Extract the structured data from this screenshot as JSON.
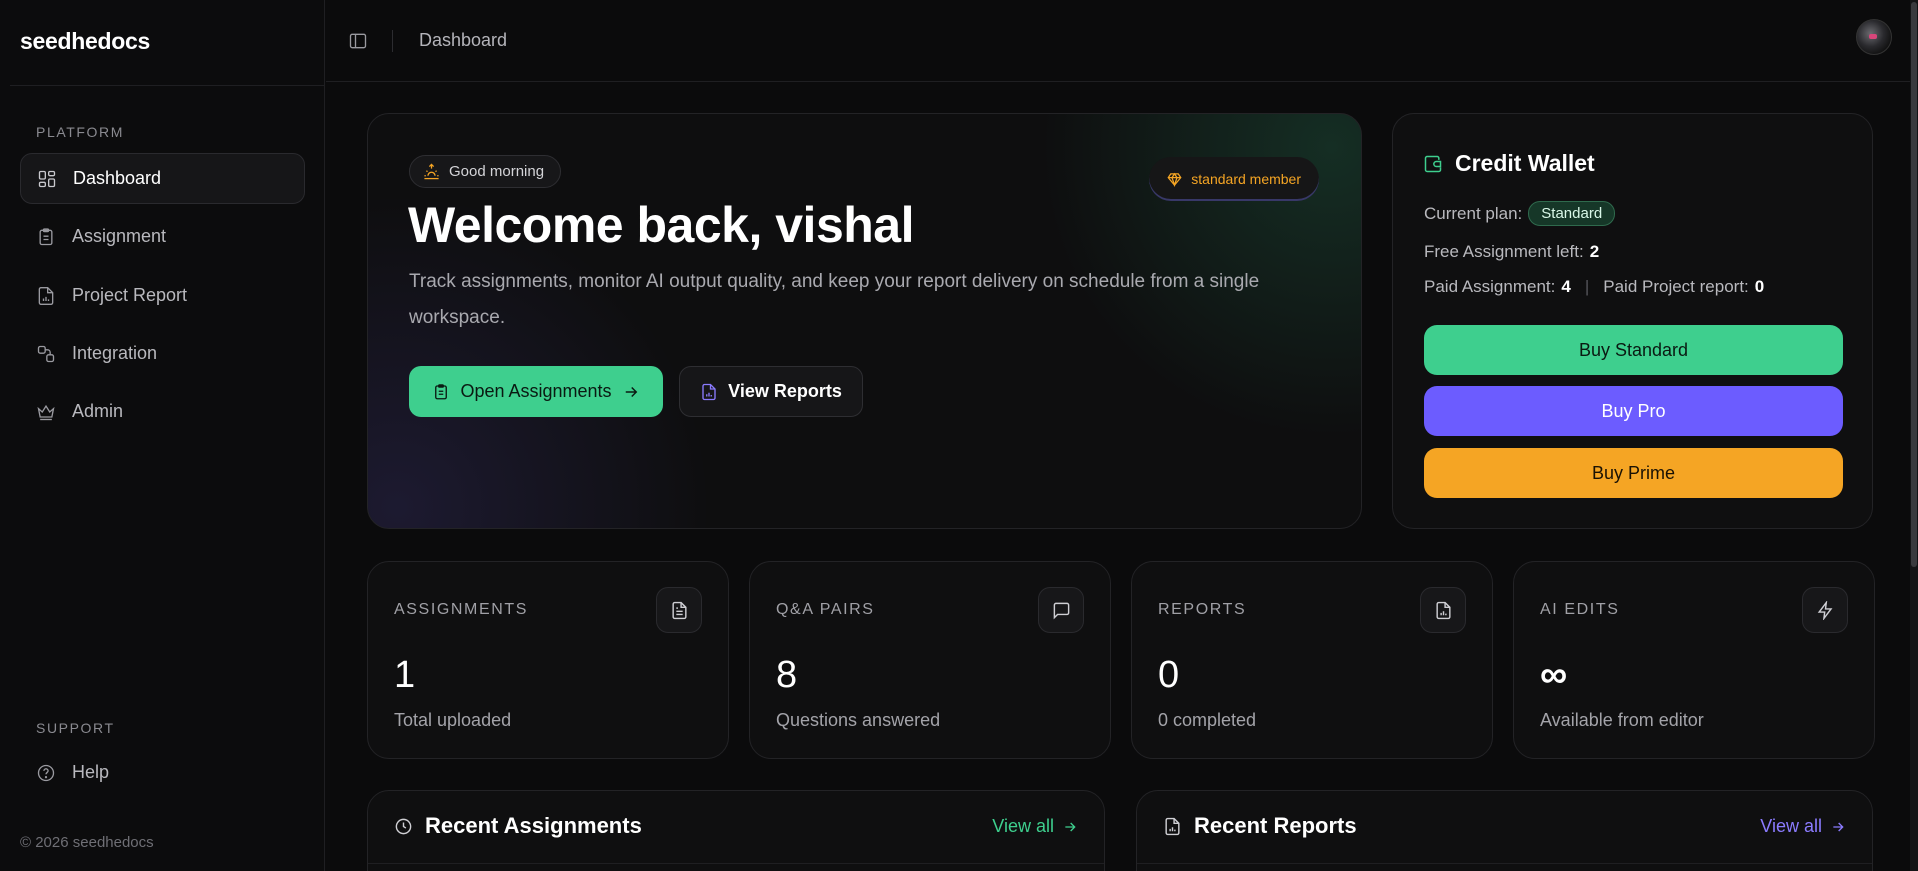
{
  "brand": "seedhedocs",
  "sidebar": {
    "platform_label": "PLATFORM",
    "items": [
      {
        "label": "Dashboard",
        "icon": "grid-icon"
      },
      {
        "label": "Assignment",
        "icon": "clipboard-icon"
      },
      {
        "label": "Project Report",
        "icon": "file-chart-icon"
      },
      {
        "label": "Integration",
        "icon": "integration-icon"
      },
      {
        "label": "Admin",
        "icon": "crown-icon"
      }
    ],
    "support_label": "SUPPORT",
    "support_items": [
      {
        "label": "Help",
        "icon": "help-circle-icon"
      }
    ],
    "footer": "© 2026 seedhedocs"
  },
  "topbar": {
    "breadcrumb": "Dashboard"
  },
  "hero": {
    "greeting": "Good morning",
    "member_badge": "standard member",
    "title": "Welcome back, vishal",
    "description": "Track assignments, monitor AI output quality, and keep your report delivery on schedule from a single workspace.",
    "primary_button": "Open Assignments",
    "secondary_button": "View Reports"
  },
  "wallet": {
    "title": "Credit Wallet",
    "plan_label": "Current plan:",
    "plan_value": "Standard",
    "free_label": "Free Assignment left:",
    "free_value": "2",
    "paid_assign_label": "Paid Assignment:",
    "paid_assign_value": "4",
    "paid_report_label": "Paid Project report:",
    "paid_report_value": "0",
    "buttons": {
      "standard": "Buy Standard",
      "pro": "Buy Pro",
      "prime": "Buy Prime"
    }
  },
  "stats": [
    {
      "label": "ASSIGNMENTS",
      "value": "1",
      "sub": "Total uploaded",
      "icon": "document-icon"
    },
    {
      "label": "Q&A PAIRS",
      "value": "8",
      "sub": "Questions answered",
      "icon": "chat-icon"
    },
    {
      "label": "REPORTS",
      "value": "0",
      "sub": "0 completed",
      "icon": "file-chart-icon"
    },
    {
      "label": "AI EDITS",
      "value": "∞",
      "sub": "Available from editor",
      "icon": "lightning-icon"
    }
  ],
  "recent_assignments": {
    "title": "Recent Assignments",
    "link": "View all"
  },
  "recent_reports": {
    "title": "Recent Reports",
    "link": "View all"
  },
  "colors": {
    "green_accent": "#3ecf8e",
    "purple_accent": "#6c5cff",
    "orange_accent": "#f5a524",
    "background": "#0b0b0c"
  }
}
